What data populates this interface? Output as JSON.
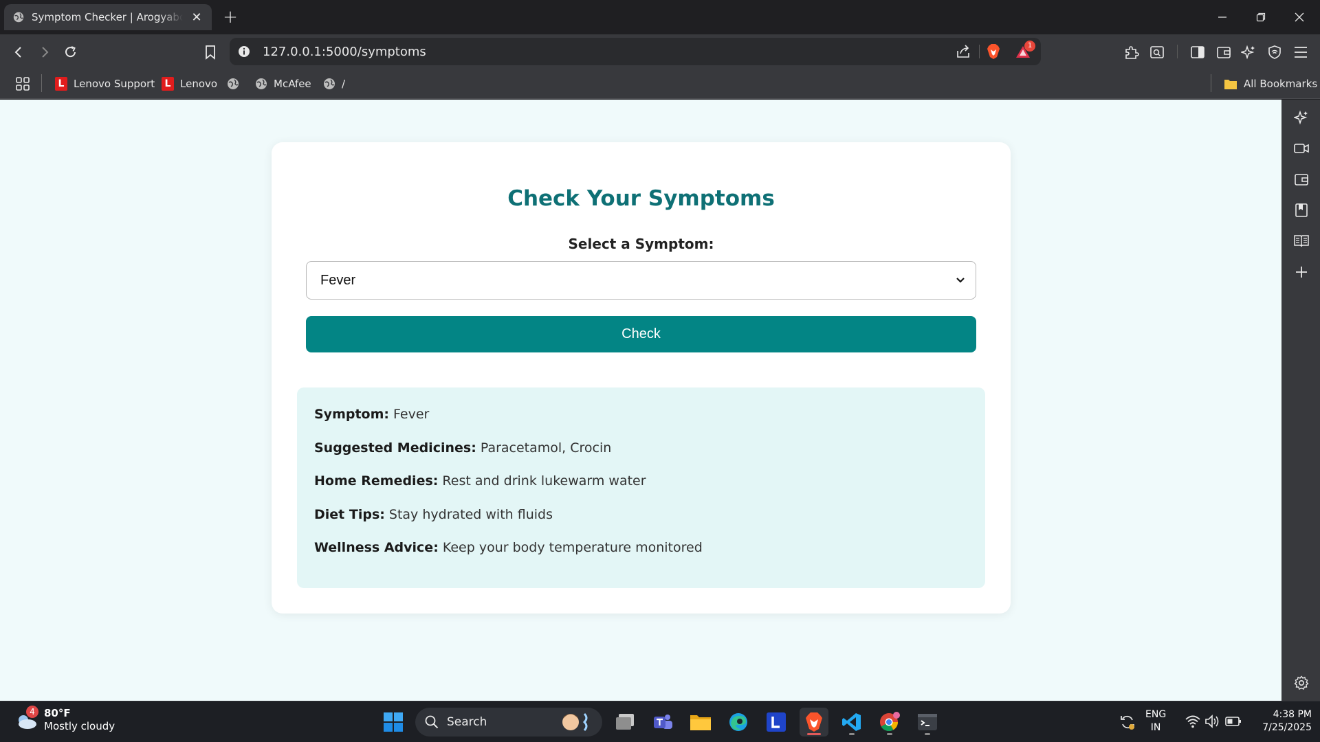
{
  "browser": {
    "tab_title": "Symptom Checker | Arogyabodh",
    "url": "127.0.0.1:5000/symptoms",
    "notification_count": "1",
    "bookmarks": [
      {
        "label": "Lenovo Support",
        "icon": "lenovo-logo"
      },
      {
        "label": "Lenovo",
        "icon": "lenovo-logo"
      },
      {
        "label": "",
        "icon": "globe-icon"
      },
      {
        "label": "McAfee",
        "icon": "globe-icon"
      },
      {
        "label": "/",
        "icon": "globe-icon"
      }
    ],
    "all_bookmarks_label": "All Bookmarks"
  },
  "page": {
    "heading": "Check Your Symptoms",
    "select_label": "Select a Symptom:",
    "selected_symptom": "Fever",
    "check_button": "Check",
    "result": {
      "symptom_label": "Symptom:",
      "symptom_value": "Fever",
      "medicines_label": "Suggested Medicines:",
      "medicines_value": "Paracetamol, Crocin",
      "remedies_label": "Home Remedies:",
      "remedies_value": "Rest and drink lukewarm water",
      "diet_label": "Diet Tips:",
      "diet_value": "Stay hydrated with fluids",
      "wellness_label": "Wellness Advice:",
      "wellness_value": "Keep your body temperature monitored"
    }
  },
  "taskbar": {
    "weather_temp": "80°F",
    "weather_desc": "Mostly cloudy",
    "weather_badge": "4",
    "search_label": "Search",
    "language": "ENG",
    "region": "IN",
    "time": "4:38 PM",
    "date": "7/25/2025"
  },
  "colors": {
    "accent": "#038585",
    "heading": "#0e7075",
    "page_bg": "#f0fafb",
    "result_bg": "#e3f6f6"
  }
}
